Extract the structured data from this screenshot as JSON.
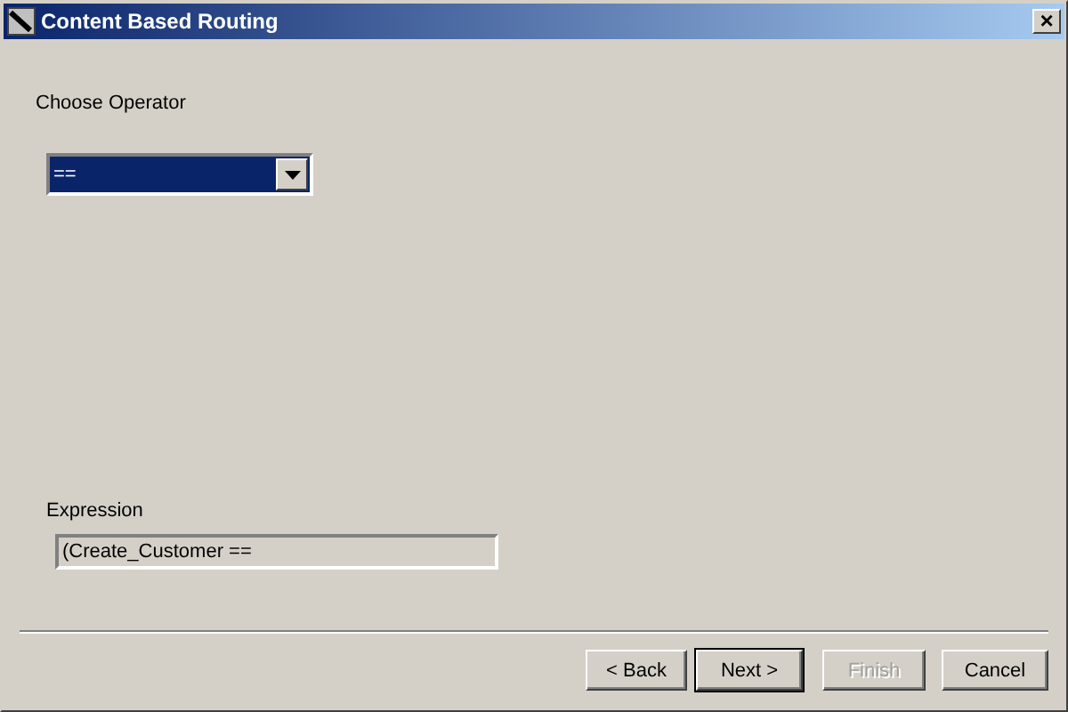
{
  "window": {
    "title": "Content Based Routing",
    "close": "×"
  },
  "operator": {
    "label": "Choose Operator",
    "value": "==",
    "selected": true
  },
  "expression": {
    "label": "Expression",
    "value": "(Create_Customer =="
  },
  "buttons": [
    {
      "label": "< Back",
      "disabled": false,
      "default": false
    },
    {
      "label": "Next >",
      "disabled": false,
      "default": true
    },
    {
      "label": "Finish",
      "disabled": true,
      "default": false
    },
    {
      "label": "Cancel",
      "disabled": false,
      "default": false
    }
  ]
}
